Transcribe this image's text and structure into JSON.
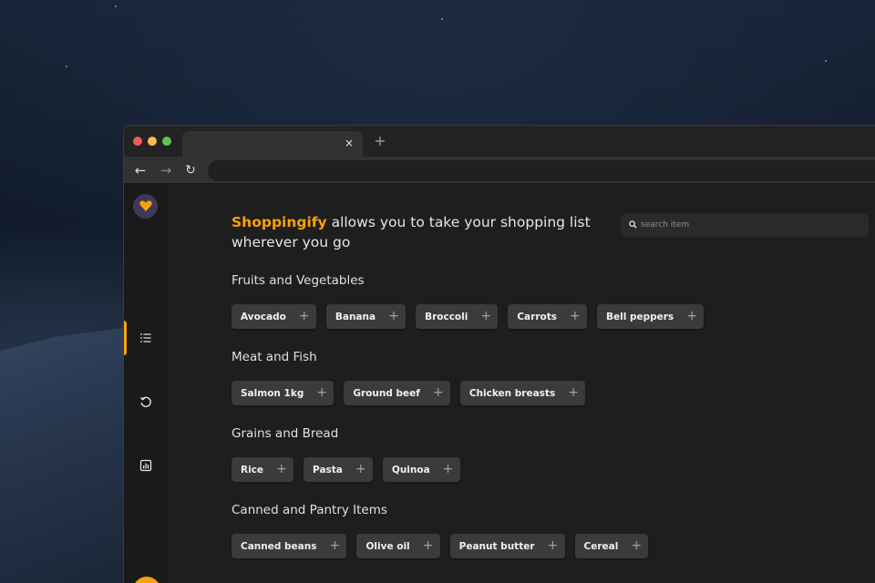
{
  "browser": {
    "tab_close": "×",
    "new_tab": "+",
    "back": "←",
    "forward": "→",
    "reload": "↻"
  },
  "app": {
    "brand": "Shoppingify",
    "tagline": " allows you to take your shopping list wherever you go",
    "search": {
      "placeholder": "search item"
    },
    "colors": {
      "accent": "#f9a109",
      "item_bg": "#3b3b3d",
      "background": "#1e1e1f"
    },
    "sidebar": {
      "items": [
        {
          "icon": "list-icon",
          "active": true
        },
        {
          "icon": "history-icon",
          "active": false
        },
        {
          "icon": "statistics-icon",
          "active": false
        }
      ]
    },
    "categories": [
      {
        "title": "Fruits and Vegetables",
        "items": [
          "Avocado",
          "Banana",
          "Broccoli",
          "Carrots",
          "Bell peppers"
        ]
      },
      {
        "title": "Meat and Fish",
        "items": [
          "Salmon 1kg",
          "Ground beef",
          "Chicken breasts"
        ]
      },
      {
        "title": "Grains and Bread",
        "items": [
          "Rice",
          "Pasta",
          "Quinoa"
        ]
      },
      {
        "title": "Canned and Pantry Items",
        "items": [
          "Canned beans",
          "Olive oil",
          "Peanut butter",
          "Cereal"
        ]
      }
    ],
    "add_symbol": "+"
  }
}
